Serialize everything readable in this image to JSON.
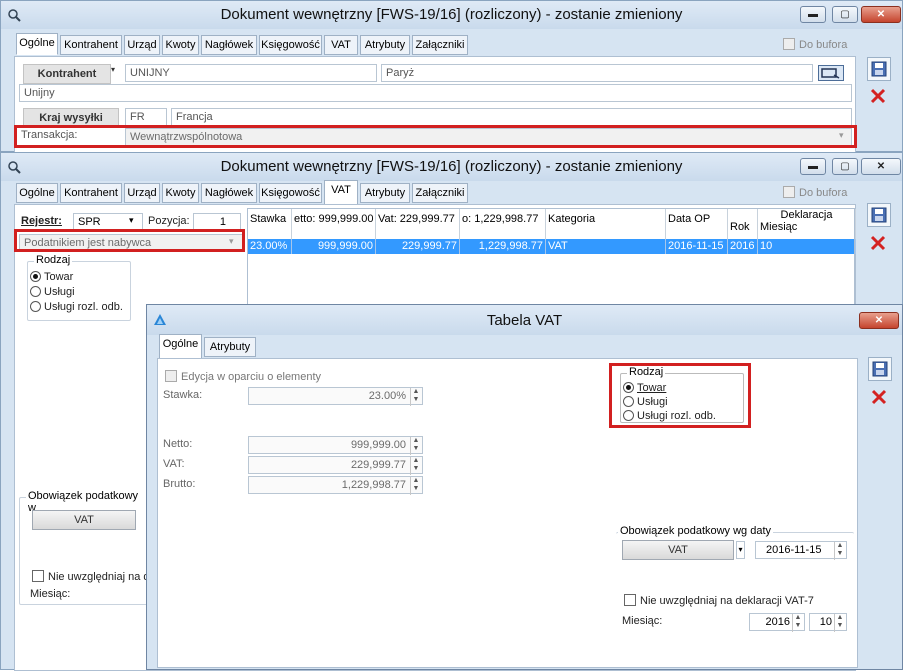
{
  "win1": {
    "title": "Dokument wewnętrzny [FWS-19/16] (rozliczony) - zostanie zmieniony",
    "tabs": [
      "Ogólne",
      "Kontrahent",
      "Urząd",
      "Kwoty",
      "Nagłówek",
      "Księgowość",
      "VAT",
      "Atrybuty",
      "Załączniki"
    ],
    "active_tab": "Ogólne",
    "do_bufora": "Do bufora",
    "kontrahent_label": "Kontrahent",
    "kontrahent_code": "UNIJNY",
    "kontrahent_city": "Paryż",
    "kontrahent_name": "Unijny",
    "kraj_label": "Kraj wysyłki",
    "kraj_code": "FR",
    "kraj_name": "Francja",
    "transakcja_label": "Transakcja:",
    "transakcja_value": "Wewnątrzwspólnotowa"
  },
  "win2": {
    "title": "Dokument wewnętrzny [FWS-19/16] (rozliczony) - zostanie zmieniony",
    "tabs": [
      "Ogólne",
      "Kontrahent",
      "Urząd",
      "Kwoty",
      "Nagłówek",
      "Księgowość",
      "VAT",
      "Atrybuty",
      "Załączniki"
    ],
    "active_tab": "VAT",
    "do_bufora": "Do bufora",
    "rejestr_label": "Rejestr:",
    "rejestr_value": "SPR",
    "pozycja_label": "Pozycja:",
    "pozycja_value": "1",
    "podatnik_value": "Podatnikiem jest nabywca",
    "rodzaj_title": "Rodzaj",
    "rodzaj_options": [
      "Towar",
      "Usługi",
      "Usługi rozl. odb."
    ],
    "rodzaj_selected": 0,
    "obowiazek_label": "Obowiązek podatkowy w",
    "obowiazek_btn": "VAT",
    "nie_uwzgledniaj": "Nie uwzględniaj na de",
    "miesiac_label": "Miesiąc:",
    "table_headers": [
      "Stawka",
      "etto: 999,999.00",
      "Vat: 229,999.77",
      "o: 1,229,998.77",
      "Kategoria",
      "Data OP",
      "Rok",
      "Deklaracja Miesiąc"
    ],
    "table_header_deklaracja": "Deklaracja",
    "table_header_miesiac": "Miesiąc",
    "table_row": [
      "23.00%",
      "999,999.00",
      "229,999.77",
      "1,229,998.77",
      "VAT",
      "2016-11-15",
      "2016",
      "10"
    ]
  },
  "dialog": {
    "title": "Tabela VAT",
    "tabs": [
      "Ogólne",
      "Atrybuty"
    ],
    "edycja_label": "Edycja w oparciu o elementy",
    "stawka_label": "Stawka:",
    "stawka_value": "23.00%",
    "netto_label": "Netto:",
    "netto_value": "999,999.00",
    "vat_label": "VAT:",
    "vat_value": "229,999.77",
    "brutto_label": "Brutto:",
    "brutto_value": "1,229,998.77",
    "rodzaj_title": "Rodzaj",
    "rodzaj_options": [
      "Towar",
      "Usługi",
      "Usługi rozl. odb."
    ],
    "rodzaj_selected": 0,
    "obowiazek_title": "Obowiązek podatkowy wg daty",
    "obowiazek_btn": "VAT",
    "obowiazek_date": "2016-11-15",
    "nie_uwzgledniaj": "Nie uwzględniaj na deklaracji VAT-7",
    "miesiac_label": "Miesiąc:",
    "rok_value": "2016",
    "miesiac_value": "10"
  },
  "colors": {
    "accent_red": "#d22020",
    "selection": "#3399ff",
    "title_bg": "#d6e4f2"
  },
  "icons": [
    "magnifier-icon",
    "minimize-icon",
    "maximize-icon",
    "close-icon",
    "save-icon",
    "cancel-icon",
    "dropdown-arrow-icon",
    "spin-arrows-icon"
  ]
}
